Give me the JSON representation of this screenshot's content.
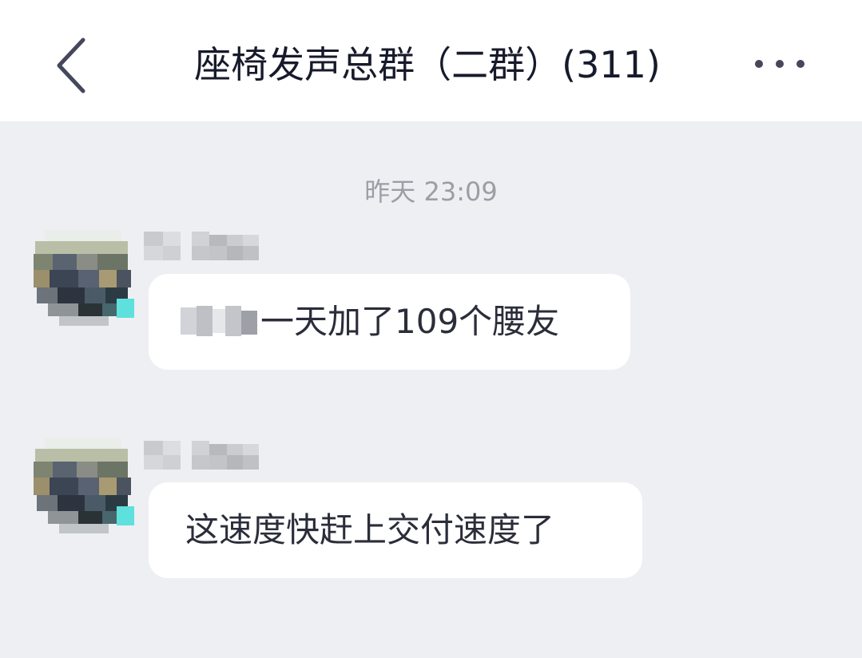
{
  "header": {
    "title": "座椅发声总群（二群）(311)",
    "back_icon": "chevron-left-icon",
    "more_icon": "more-dots-icon"
  },
  "chat": {
    "timestamp": "昨天 23:09",
    "messages": [
      {
        "sender": "redacted",
        "text": "一天加了109个腰友"
      },
      {
        "sender": "redacted",
        "text": "这速度快赶上交付速度了"
      }
    ]
  },
  "colors": {
    "background": "#eeeff3",
    "header_bg": "#ffffff",
    "bubble_bg": "#ffffff",
    "title_text": "#171a2b",
    "message_text": "#2b2d3a",
    "timestamp_text": "#9c9ea6"
  }
}
